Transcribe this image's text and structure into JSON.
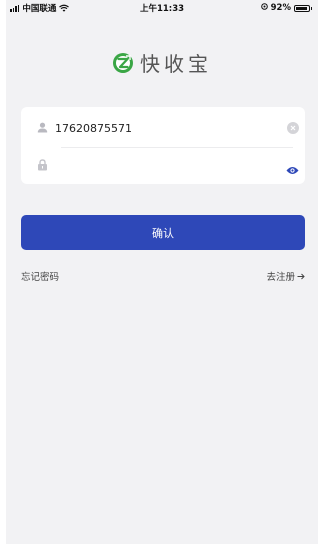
{
  "status_bar": {
    "carrier": "中国联通",
    "time": "上午11:33",
    "battery_percent": "92%",
    "battery_level": 0.92
  },
  "logo": {
    "text": "快收宝",
    "mark_letter": "Z",
    "brand_color": "#3aa645"
  },
  "login_form": {
    "phone_value": "17620875571",
    "password_value": ""
  },
  "buttons": {
    "confirm_label": "确认"
  },
  "links": {
    "forgot_password": "忘记密码",
    "register": "去注册"
  },
  "icons": {
    "user": "user-icon",
    "lock": "lock-icon",
    "clear": "clear-icon",
    "eye": "eye-icon",
    "arrow": "arrow-right-icon",
    "wifi": "wifi-icon",
    "signal": "signal-icon",
    "battery": "battery-icon",
    "location": "location-icon"
  },
  "colors": {
    "primary": "#2e48b8",
    "eye": "#2e48b8",
    "background": "#f2f2f4"
  }
}
